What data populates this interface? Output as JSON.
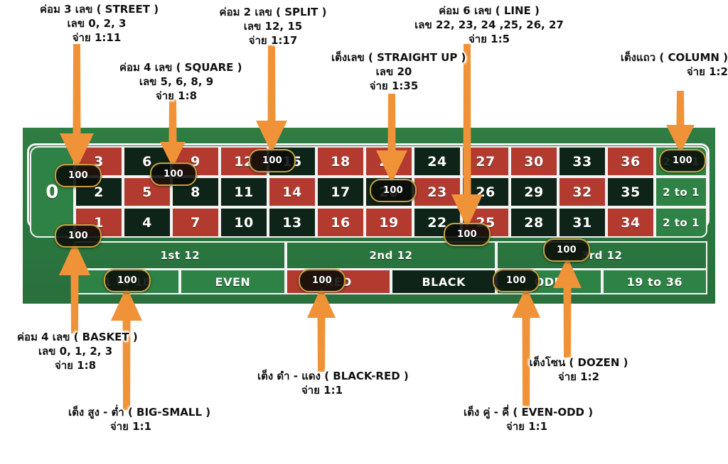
{
  "table": {
    "zero_label": "0",
    "numbers_top_row": [
      "3",
      "6",
      "9",
      "12",
      "15",
      "18",
      "21",
      "24",
      "27",
      "30",
      "33",
      "36"
    ],
    "numbers_mid_row": [
      "2",
      "5",
      "8",
      "11",
      "14",
      "17",
      "20",
      "23",
      "26",
      "29",
      "32",
      "35"
    ],
    "numbers_bottom_row": [
      "1",
      "4",
      "7",
      "10",
      "13",
      "16",
      "19",
      "22",
      "25",
      "28",
      "31",
      "34"
    ],
    "colors_top_row": [
      "red",
      "black",
      "red",
      "red",
      "black",
      "red",
      "red",
      "black",
      "red",
      "red",
      "black",
      "red"
    ],
    "colors_mid_row": [
      "black",
      "red",
      "black",
      "black",
      "red",
      "black",
      "black",
      "red",
      "black",
      "black",
      "red",
      "black"
    ],
    "colors_bottom_row": [
      "red",
      "black",
      "red",
      "black",
      "black",
      "red",
      "red",
      "black",
      "red",
      "black",
      "black",
      "red"
    ],
    "column_bets": [
      "2 to 1",
      "2 to 1",
      "2 to 1"
    ],
    "dozens": [
      "1st 12",
      "2nd 12",
      "3rd 12"
    ],
    "outside_bets": [
      "1 to 18",
      "EVEN",
      "RED",
      "BLACK",
      "ODD",
      "19 to 36"
    ]
  },
  "chips": [
    {
      "name": "chip-street-0-2-3",
      "value": "100"
    },
    {
      "name": "chip-square-5-6-8-9",
      "value": "100"
    },
    {
      "name": "chip-split-12-15",
      "value": "100"
    },
    {
      "name": "chip-straight-20",
      "value": "100"
    },
    {
      "name": "chip-line-22-27",
      "value": "100"
    },
    {
      "name": "chip-column-2to1",
      "value": "100"
    },
    {
      "name": "chip-basket-0-1-2-3",
      "value": "100"
    },
    {
      "name": "chip-1-to-18",
      "value": "100"
    },
    {
      "name": "chip-red",
      "value": "100"
    },
    {
      "name": "chip-odd",
      "value": "100"
    },
    {
      "name": "chip-3rd-12",
      "value": "100"
    }
  ],
  "callouts": {
    "street": {
      "line1": "ค่อม 3 เลข ( STREET )",
      "line2": "เลข 0, 2, 3",
      "line3": "จ่าย 1:11"
    },
    "square": {
      "line1": "ค่อม 4 เลข ( SQUARE )",
      "line2": "เลข 5, 6, 8, 9",
      "line3": "จ่าย 1:8"
    },
    "split": {
      "line1": "ค่อม 2 เลข ( SPLIT )",
      "line2": "เลข 12, 15",
      "line3": "จ่าย 1:17"
    },
    "straight_up": {
      "line1": "เต็งเลข ( STRAIGHT UP )",
      "line2": "เลข 20",
      "line3": "จ่าย 1:35"
    },
    "line": {
      "line1": "ค่อม 6 เลข ( LINE )",
      "line2": "เลข 22, 23, 24 ,25, 26, 27",
      "line3": "จ่าย 1:5"
    },
    "column": {
      "line1": "เต็งแถว ( COLUMN )",
      "line2": "จ่าย 1:2",
      "line3": ""
    },
    "basket": {
      "line1": "ค่อม 4 เลข ( BASKET )",
      "line2": "เลข 0, 1, 2, 3",
      "line3": "จ่าย 1:8"
    },
    "big_small": {
      "line1": "เต็ง สูง - ต่ำ ( BIG-SMALL )",
      "line2": "จ่าย 1:1",
      "line3": ""
    },
    "black_red": {
      "line1": "เต็ง ดำ - แดง ( BLACK-RED )",
      "line2": "จ่าย 1:1",
      "line3": ""
    },
    "even_odd": {
      "line1": "เต็ง คู่ - คี่ ( EVEN-ODD )",
      "line2": "จ่าย 1:1",
      "line3": ""
    },
    "dozen": {
      "line1": "เต็งโซน ( DOZEN )",
      "line2": "จ่าย 1:2",
      "line3": ""
    }
  },
  "colors": {
    "felt": "#2d7a41",
    "red_cell": "#b23a2f",
    "black_cell": "#0e2418",
    "green_cell": "#2f8245",
    "arrow": "#f09338",
    "chip_border": "#c8a03a",
    "grid_line": "#f4f4f4"
  }
}
